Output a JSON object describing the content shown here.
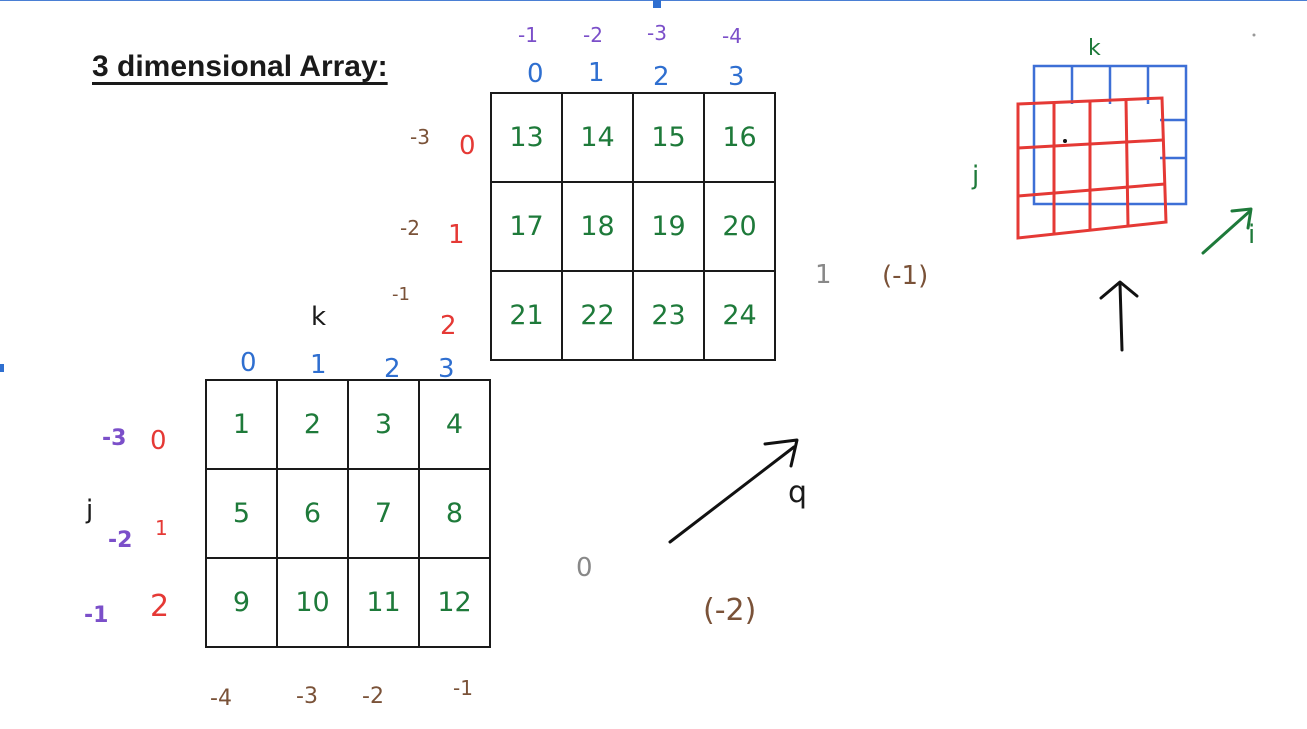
{
  "title": "3 dimensional Array:",
  "colors": {
    "negative_index": "#7b4fc9",
    "column_index": "#2f6fd0",
    "row_index": "#e53935",
    "values": "#1e7a3a",
    "page_label": "#7a5238",
    "back_sketch": "#2f6fd0",
    "front_sketch": "#e53935"
  },
  "back_matrix": {
    "col_negative": [
      "-1",
      "-2",
      "-3",
      "-4"
    ],
    "col_index": [
      "0",
      "1",
      "2",
      "3"
    ],
    "row_negative": [
      "-3",
      "-2",
      "-1"
    ],
    "row_index": [
      "0",
      "1",
      "2"
    ],
    "cells": [
      "13",
      "14",
      "15",
      "16",
      "17",
      "18",
      "19",
      "20",
      "21",
      "22",
      "23",
      "24"
    ],
    "page_index": "1",
    "page_negative": "(-1)"
  },
  "front_matrix": {
    "axis_k": "k",
    "axis_j": "j",
    "col_index": [
      "0",
      "1",
      "2",
      "3"
    ],
    "row_negative": [
      "-3",
      "-2",
      "-1"
    ],
    "row_index": [
      "0",
      "1",
      "2"
    ],
    "cells": [
      "1",
      "2",
      "3",
      "4",
      "5",
      "6",
      "7",
      "8",
      "9",
      "10",
      "11",
      "12"
    ],
    "col_negative": [
      "-4",
      "-3",
      "-2",
      "-1"
    ],
    "page_index": "0",
    "page_negative": "(-2)"
  },
  "depth_arrow_label": "q",
  "sketch": {
    "axis_k": "k",
    "axis_j": "j",
    "axis_i": "i"
  }
}
